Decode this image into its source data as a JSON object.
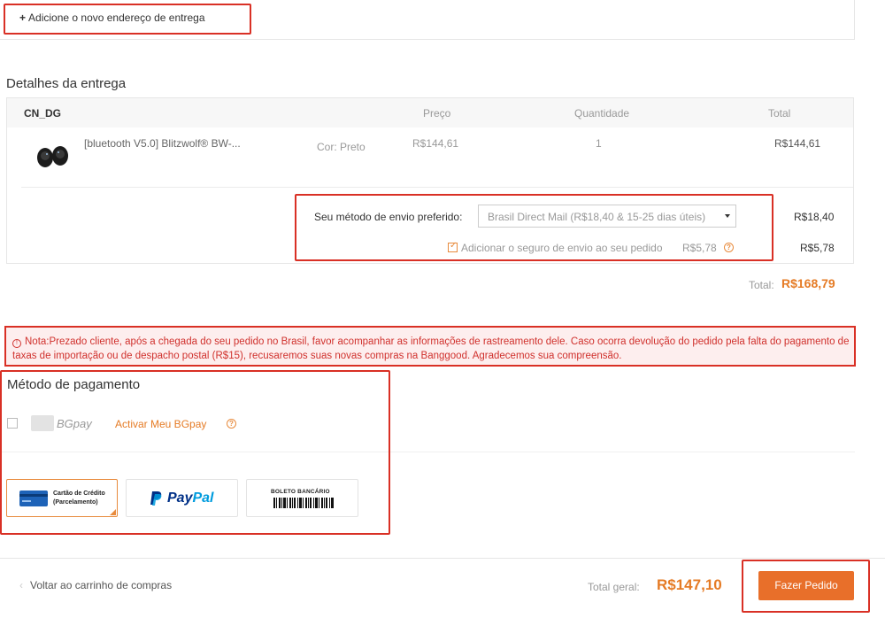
{
  "address": {
    "add_label": "Adicione o novo endereço de entrega",
    "plus": "+"
  },
  "delivery": {
    "title": "Detalhes da entrega",
    "warehouse": "CN_DG",
    "headers": {
      "price": "Preço",
      "quantity": "Quantidade",
      "total": "Total"
    },
    "product": {
      "name": "[bluetooth V5.0] Blitzwolf® BW-...",
      "color": "Cor: Preto",
      "price": "R$144,61",
      "quantity": "1",
      "total": "R$144,61"
    },
    "shipping": {
      "label": "Seu método de envio preferido:",
      "selected": "Brasil Direct Mail (R$18,40 & 15-25 dias úteis)",
      "cost": "R$18,40"
    },
    "insurance": {
      "label": "Adicionar o seguro de envio ao seu pedido",
      "price": "R$5,78",
      "total": "R$5,78",
      "checked": true
    },
    "total_label": "Total:",
    "total_value": "R$168,79"
  },
  "notice": {
    "icon": "!",
    "text": "Nota:Prezado cliente, após a chegada do seu pedido no Brasil, favor acompanhar as informações de rastreamento dele. Caso ocorra devolução do pedido pela falta do pagamento de taxas de importação ou de despacho postal (R$15), recusaremos suas novas compras na Banggood. Agradecemos sua compreensão."
  },
  "payment": {
    "title": "Método de pagamento",
    "bgpay_label": "BGpay",
    "bgpay_activate": "Activar Meu BGpay",
    "credit_card_line1": "Cartão de Crédito",
    "credit_card_line2": "(Parcelamento)",
    "paypal_pay": "Pay",
    "paypal_pal": "Pal",
    "boleto_label": "BOLETO BANCÁRIO"
  },
  "footer": {
    "back_label": "Voltar ao carrinho de compras",
    "total_label": "Total geral:",
    "total_value": "R$147,10",
    "place_order": "Fazer Pedido"
  },
  "colors": {
    "accent": "#e86f2a",
    "highlight_border": "#d93025",
    "notice_text": "#d0312d"
  }
}
